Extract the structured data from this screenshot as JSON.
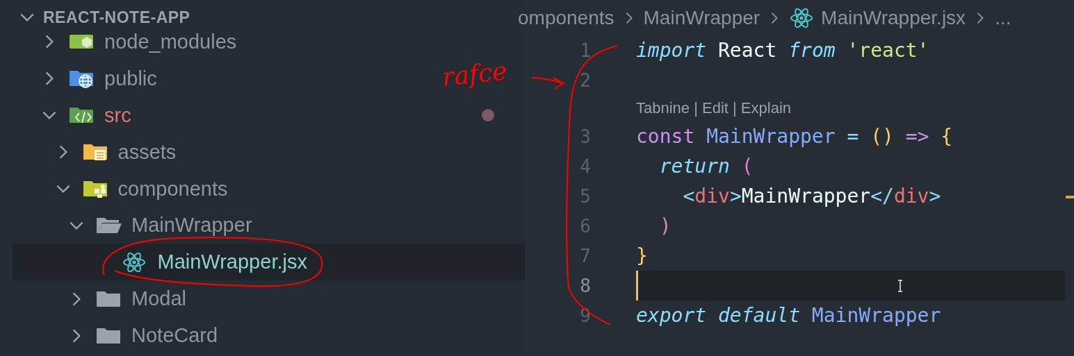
{
  "explorer": {
    "title": "REACT-NOTE-APP",
    "expanded": true,
    "items": [
      {
        "label": "node_modules",
        "kind": "node-folder",
        "expanded": false,
        "selected": false,
        "modified": false
      },
      {
        "label": "public",
        "kind": "globe-folder",
        "expanded": false,
        "selected": false,
        "modified": false
      },
      {
        "label": "src",
        "kind": "code-folder",
        "expanded": true,
        "selected": false,
        "modified": true,
        "children": [
          {
            "label": "assets",
            "kind": "assets-folder",
            "expanded": false,
            "selected": false,
            "modified": false
          },
          {
            "label": "components",
            "kind": "components-folder",
            "expanded": true,
            "selected": false,
            "modified": false,
            "children": [
              {
                "label": "MainWrapper",
                "kind": "folder",
                "expanded": true,
                "selected": false,
                "modified": false,
                "children": [
                  {
                    "label": "MainWrapper.jsx",
                    "kind": "react-file",
                    "selected": true,
                    "modified": false
                  }
                ]
              },
              {
                "label": "Modal",
                "kind": "folder",
                "expanded": false,
                "selected": false,
                "modified": false
              },
              {
                "label": "NoteCard",
                "kind": "folder",
                "expanded": false,
                "selected": false,
                "modified": false
              }
            ]
          }
        ]
      }
    ]
  },
  "editor": {
    "breadcrumb": [
      {
        "label": "omponents",
        "kind": "folder"
      },
      {
        "label": "MainWrapper",
        "kind": "folder"
      },
      {
        "label": "MainWrapper.jsx",
        "kind": "react-file"
      },
      {
        "label": "...",
        "kind": "more"
      }
    ],
    "lines": [
      {
        "kind": "code",
        "number": "1",
        "current": false,
        "tokens": [
          {
            "text": "import",
            "kind": "keyword"
          },
          {
            "text": " React ",
            "kind": "plain"
          },
          {
            "text": "from",
            "kind": "keyword"
          },
          {
            "text": " 'react'",
            "kind": "string"
          }
        ]
      },
      {
        "kind": "code",
        "number": "2",
        "current": false
      },
      {
        "kind": "codelens",
        "text": "Tabnine | Edit | Explain"
      },
      {
        "kind": "code",
        "number": "3",
        "current": false,
        "tokens": [
          {
            "text": "const",
            "kind": "storage"
          },
          {
            "text": " MainWrapper",
            "kind": "function"
          },
          {
            "text": " = ",
            "kind": "operator"
          },
          {
            "text": "()",
            "kind": "bracket"
          },
          {
            "text": " => ",
            "kind": "storage"
          },
          {
            "text": "{",
            "kind": "bracket"
          }
        ]
      },
      {
        "kind": "code",
        "number": "4",
        "current": false,
        "tokens": [
          {
            "text": "  return",
            "kind": "keyword"
          },
          {
            "text": " (",
            "kind": "paren"
          }
        ]
      },
      {
        "kind": "code",
        "number": "5",
        "current": false,
        "tokens": [
          {
            "text": "    <",
            "kind": "operator"
          },
          {
            "text": "div",
            "kind": "tag"
          },
          {
            "text": ">",
            "kind": "operator"
          },
          {
            "text": "MainWrapper",
            "kind": "plain"
          },
          {
            "text": "</",
            "kind": "operator"
          },
          {
            "text": "div",
            "kind": "tag"
          },
          {
            "text": ">",
            "kind": "operator"
          }
        ]
      },
      {
        "kind": "code",
        "number": "6",
        "current": false,
        "tokens": [
          {
            "text": "  )",
            "kind": "paren"
          }
        ]
      },
      {
        "kind": "code",
        "number": "7",
        "current": false,
        "tokens": [
          {
            "text": "}",
            "kind": "bracket"
          }
        ]
      },
      {
        "kind": "code",
        "number": "8",
        "current": true
      },
      {
        "kind": "code",
        "number": "9",
        "current": false,
        "tokens": [
          {
            "text": "export",
            "kind": "keyword"
          },
          {
            "text": " default",
            "kind": "keyword"
          },
          {
            "text": " MainWrapper",
            "kind": "function"
          }
        ]
      }
    ]
  },
  "annotation": {
    "note": "rafce",
    "color": "#ff0000"
  }
}
